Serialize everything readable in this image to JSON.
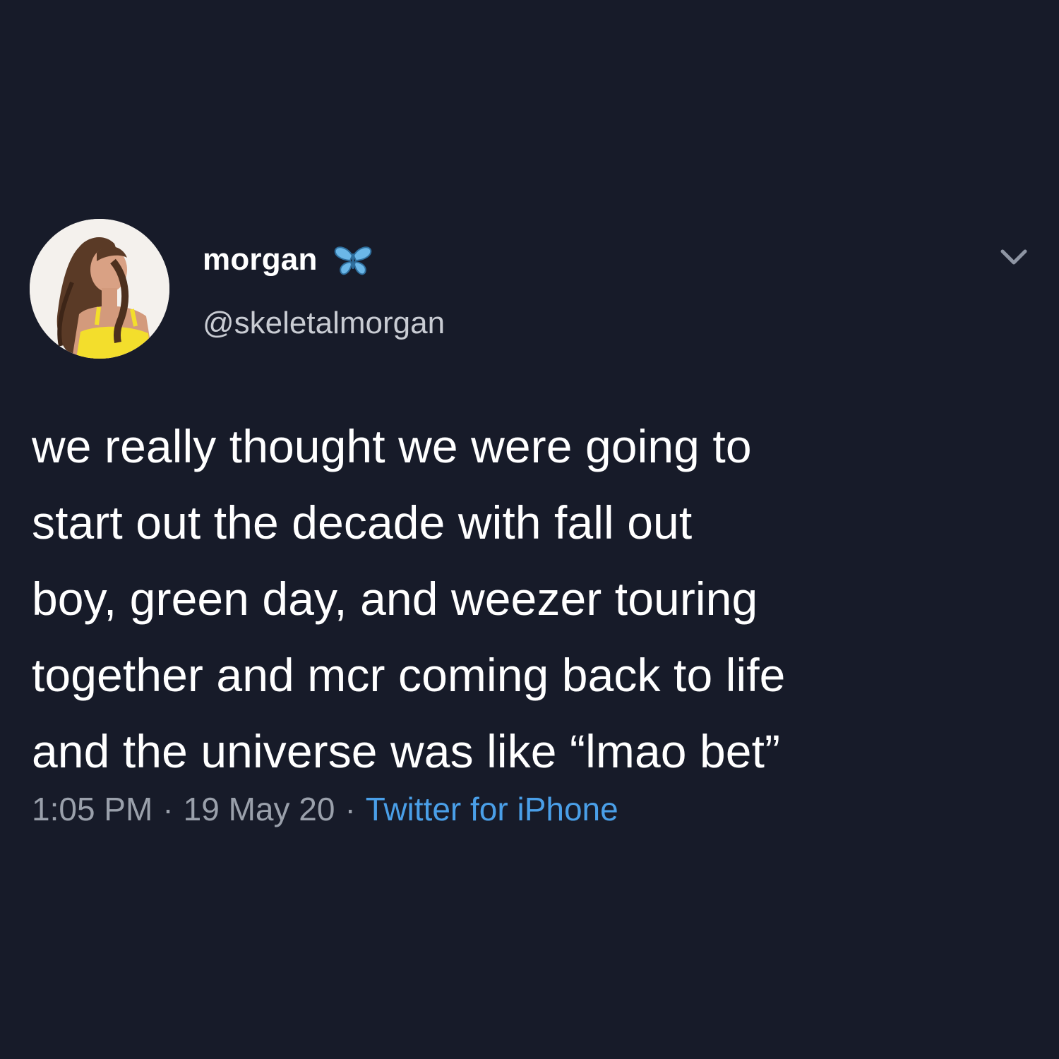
{
  "user": {
    "display_name": "morgan",
    "handle": "@skeletalmorgan",
    "display_name_emoji": "butterfly-icon",
    "avatar": "avatar"
  },
  "tweet": {
    "lines": [
      "we really thought we were going to",
      "start out the decade with fall out",
      "boy, green day, and weezer touring",
      "together and mcr coming back to life",
      "and the universe was like “lmao bet”"
    ]
  },
  "meta": {
    "time": "1:05 PM",
    "separator": "·",
    "date": "19 May 20",
    "source": "Twitter for iPhone"
  },
  "colors": {
    "background": "#171b29",
    "text": "#ffffff",
    "secondary_text": "#9aa0ab",
    "link": "#4a9fe8",
    "butterfly": "#6bb7e8"
  },
  "icons": {
    "menu": "chevron-down-icon"
  }
}
